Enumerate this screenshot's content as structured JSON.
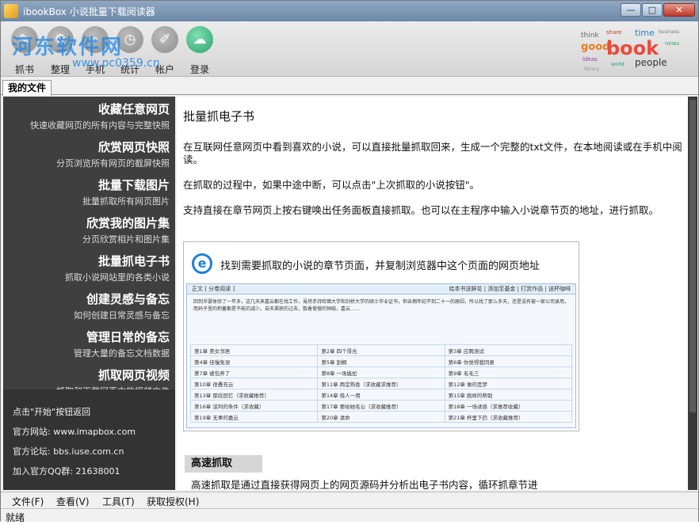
{
  "window": {
    "title": "ibookBox 小说批量下载阅读器",
    "min": "—",
    "max": "□",
    "close": "✕"
  },
  "watermark": {
    "line1": "河东软件网",
    "line2": "www.pc0359.cn"
  },
  "toolbar": {
    "items": [
      {
        "label": "抓书",
        "icon": "book-icon",
        "glyph": "✎"
      },
      {
        "label": "整理",
        "icon": "organize-icon",
        "glyph": "⚙"
      },
      {
        "label": "手机",
        "icon": "phone-icon",
        "glyph": "⌕"
      },
      {
        "label": "统计",
        "icon": "stats-icon",
        "glyph": "◷"
      },
      {
        "label": "帐户",
        "icon": "account-icon",
        "glyph": "✐"
      },
      {
        "label": "登录",
        "icon": "cloud-upload-icon",
        "glyph": "☁"
      }
    ]
  },
  "logo": {
    "words": [
      "think",
      "share",
      "book",
      "good",
      "time",
      "people",
      "business",
      "news",
      "ideas",
      "world",
      "library"
    ]
  },
  "tab": {
    "label": "我的文件"
  },
  "sidebar": {
    "items": [
      {
        "title": "收藏任意网页",
        "desc": "快速收藏网页的所有内容与完整快照"
      },
      {
        "title": "欣赏网页快照",
        "desc": "分页浏览所有网页的截屏快照"
      },
      {
        "title": "批量下载图片",
        "desc": "批量抓取所有网页图片"
      },
      {
        "title": "欣赏我的图片集",
        "desc": "分页欣赏相片和图片集"
      },
      {
        "title": "批量抓电子书",
        "desc": "抓取小说网站里的各类小说"
      },
      {
        "title": "创建灵感与备忘",
        "desc": "如何创建日常灵感与备忘"
      },
      {
        "title": "管理日常的备忘",
        "desc": "管理大量的备忘文档数据"
      },
      {
        "title": "抓取网页视频",
        "desc": "抓取和下载网页中的视频文件"
      }
    ],
    "footer": {
      "back": "点击\"开始\"按钮返回",
      "site": "官方网站: www.imapbox.com",
      "forum": "官方论坛: bbs.iuse.com.cn",
      "qq": "加入官方QQ群: 21638001"
    }
  },
  "content": {
    "title": "批量抓电子书",
    "p1": "在互联网任意网页中看到喜欢的小说，可以直接批量抓取回来，生成一个完整的txt文件，在本地阅读或在手机中阅读。",
    "p2": "在抓取的过程中，如果中途中断，可以点击\"上次抓取的小说按钮\"。",
    "p3": "支持直接在章节网页上按右键唤出任务面板直接抓取。也可以在主程序中输入小说章节页的地址，进行抓取。",
    "shot": {
      "caption": "找到需要抓取的小说的章节页面，并复制浏览器中这个页面的网页地址",
      "head_left": "正文 [ 分卷阅读 ]",
      "head_right": "给本书送鲜花 | 添加至基金 | 打赏作品 | 送杯咖啡",
      "intro": "回到半婴体验了一年多，这几天来嘉云都在找工作，虽然手持哈佛大学和剑桥大学的硕士毕业证书，但亲拥年纪不到二十一的原因，所以找了那么多天，还是没有被一家公司录用，而妈子里的积蓄都是不能的减少。自天渠狭的过去，数着慢慢的钟临，嘉云……",
      "chapters": [
        [
          "第1章 美女邻居",
          "第2章 四个哥光",
          "第3章 应聘测试"
        ],
        [
          "第4章 佳慢免误",
          "第5章 割桐",
          "第6章 你觉得我同意"
        ],
        [
          "第7章 被包养了",
          "第8章 一场尴尬",
          "第9章 毛毛三"
        ],
        [
          "第10章 很叠充云",
          "第11章 两堂购香（求收藏求推荐）",
          "第12章 做的是梦"
        ],
        [
          "第13章 那段回忆（求收藏推荐）",
          "第14章 借人一用",
          "第15章 刚样的帮助"
        ],
        [
          "第16章 谈判的条件（求收藏）",
          "第17章 要给她名公（求收藏推荐）",
          "第18章 一场诱惑（求推荐收藏）"
        ],
        [
          "第19章 无辜的嘉云",
          "第20章 请命",
          "第21章 杯里下药（求收藏推荐）"
        ]
      ]
    },
    "section_title": "高速抓取",
    "section_text": "高速抓取是通过直接获得网页上的网页源码并分析出电子书内容，循环抓章节进"
  },
  "menu": [
    "文件(F)",
    "查看(V)",
    "工具(T)",
    "获取授权(H)"
  ],
  "status": "就绪"
}
